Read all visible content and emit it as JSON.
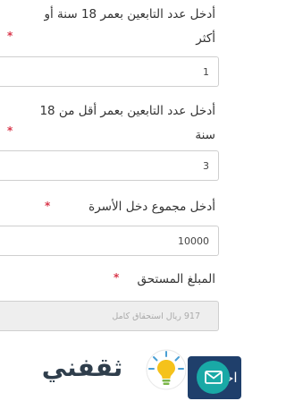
{
  "form": {
    "adults_label_line1": "أدخل عدد التابعين بعمر 18 سنة أو",
    "adults_label_line2": "أكثر",
    "adults_value": "1",
    "minors_label_line1": "أدخل عدد التابعين بعمر أقل من 18",
    "minors_label_line2": "سنة",
    "minors_value": "3",
    "income_label": "أدخل مجموع دخل الأسرة",
    "income_value": "10000",
    "amount_label": "المبلغ المستحق",
    "amount_value": "917 ريال  استحقاق كامل",
    "required_marker": "*"
  },
  "colors": {
    "required": "#d9364a",
    "button": "#1f3f6b",
    "chat": "#19a9a6",
    "logo_text": "#2f3e4c"
  },
  "submit": {
    "label": "احسب"
  },
  "logo": {
    "text": "ثقفني",
    "icon": "lightbulb-icon"
  },
  "chat": {
    "icon": "envelope-icon"
  }
}
